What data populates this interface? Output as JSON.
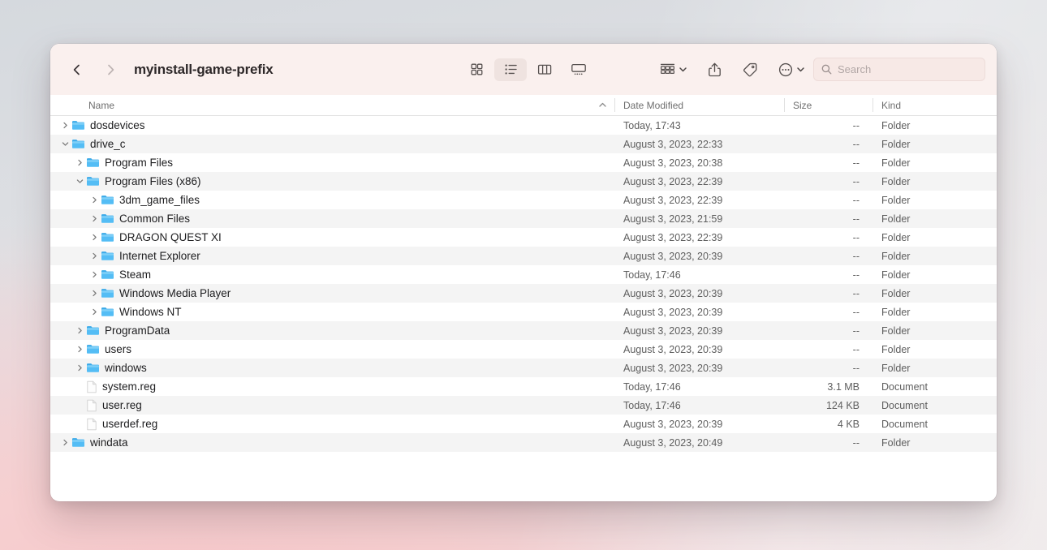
{
  "window": {
    "title": "myinstall-game-prefix",
    "toolbar": {
      "back_label": "Back",
      "forward_label": "Forward",
      "view_modes": [
        {
          "name": "icon-view",
          "label": "Icon View",
          "active": false
        },
        {
          "name": "list-view",
          "label": "List View",
          "active": true
        },
        {
          "name": "column-view",
          "label": "Column View",
          "active": false
        },
        {
          "name": "gallery-view",
          "label": "Gallery View",
          "active": false
        }
      ],
      "group_label": "Group",
      "share_label": "Share",
      "tags_label": "Tags",
      "more_label": "More"
    },
    "search": {
      "placeholder": "Search",
      "value": ""
    }
  },
  "columns": {
    "name": "Name",
    "date_modified": "Date Modified",
    "size": "Size",
    "kind": "Kind",
    "sort_column": "Name",
    "sort_direction": "ascending"
  },
  "rows": [
    {
      "name": "dosdevices",
      "depth": 0,
      "type": "folder",
      "expanded": false,
      "date": "Today, 17:43",
      "size": "--",
      "kind": "Folder"
    },
    {
      "name": "drive_c",
      "depth": 0,
      "type": "folder",
      "expanded": true,
      "date": "August 3, 2023, 22:33",
      "size": "--",
      "kind": "Folder"
    },
    {
      "name": "Program Files",
      "depth": 1,
      "type": "folder",
      "expanded": false,
      "date": "August 3, 2023, 20:38",
      "size": "--",
      "kind": "Folder"
    },
    {
      "name": "Program Files (x86)",
      "depth": 1,
      "type": "folder",
      "expanded": true,
      "date": "August 3, 2023, 22:39",
      "size": "--",
      "kind": "Folder"
    },
    {
      "name": "3dm_game_files",
      "depth": 2,
      "type": "folder",
      "expanded": false,
      "date": "August 3, 2023, 22:39",
      "size": "--",
      "kind": "Folder"
    },
    {
      "name": "Common Files",
      "depth": 2,
      "type": "folder",
      "expanded": false,
      "date": "August 3, 2023, 21:59",
      "size": "--",
      "kind": "Folder"
    },
    {
      "name": "DRAGON QUEST XI",
      "depth": 2,
      "type": "folder",
      "expanded": false,
      "date": "August 3, 2023, 22:39",
      "size": "--",
      "kind": "Folder"
    },
    {
      "name": "Internet Explorer",
      "depth": 2,
      "type": "folder",
      "expanded": false,
      "date": "August 3, 2023, 20:39",
      "size": "--",
      "kind": "Folder"
    },
    {
      "name": "Steam",
      "depth": 2,
      "type": "folder",
      "expanded": false,
      "date": "Today, 17:46",
      "size": "--",
      "kind": "Folder"
    },
    {
      "name": "Windows Media Player",
      "depth": 2,
      "type": "folder",
      "expanded": false,
      "date": "August 3, 2023, 20:39",
      "size": "--",
      "kind": "Folder"
    },
    {
      "name": "Windows NT",
      "depth": 2,
      "type": "folder",
      "expanded": false,
      "date": "August 3, 2023, 20:39",
      "size": "--",
      "kind": "Folder"
    },
    {
      "name": "ProgramData",
      "depth": 1,
      "type": "folder",
      "expanded": false,
      "date": "August 3, 2023, 20:39",
      "size": "--",
      "kind": "Folder"
    },
    {
      "name": "users",
      "depth": 1,
      "type": "folder",
      "expanded": false,
      "date": "August 3, 2023, 20:39",
      "size": "--",
      "kind": "Folder"
    },
    {
      "name": "windows",
      "depth": 1,
      "type": "folder",
      "expanded": false,
      "date": "August 3, 2023, 20:39",
      "size": "--",
      "kind": "Folder"
    },
    {
      "name": "system.reg",
      "depth": 1,
      "type": "document",
      "expanded": null,
      "date": "Today, 17:46",
      "size": "3.1 MB",
      "kind": "Document"
    },
    {
      "name": "user.reg",
      "depth": 1,
      "type": "document",
      "expanded": null,
      "date": "Today, 17:46",
      "size": "124 KB",
      "kind": "Document"
    },
    {
      "name": "userdef.reg",
      "depth": 1,
      "type": "document",
      "expanded": null,
      "date": "August 3, 2023, 20:39",
      "size": "4 KB",
      "kind": "Document"
    },
    {
      "name": "windata",
      "depth": 0,
      "type": "folder",
      "expanded": false,
      "date": "August 3, 2023, 20:49",
      "size": "--",
      "kind": "Folder"
    }
  ],
  "colors": {
    "folder_blue": "#54bdf5",
    "folder_blue_dark": "#3aa9e8",
    "toolbar_bg": "#faf0ee",
    "row_alt_bg": "#f4f4f4",
    "text_primary": "#1d1d1f",
    "text_secondary": "#5e5e5e"
  }
}
